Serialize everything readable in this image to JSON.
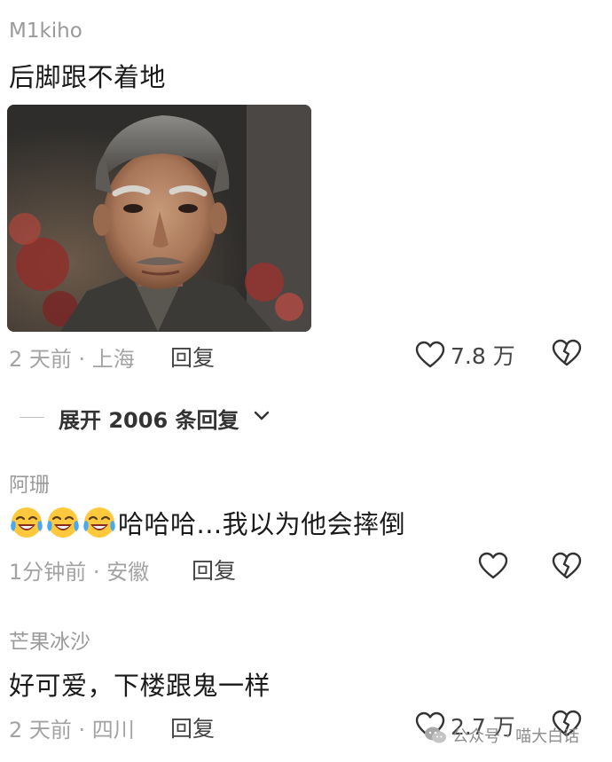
{
  "comments": [
    {
      "username": "M1kiho",
      "text": "后脚跟不着地",
      "meta": "2 天前 · 上海",
      "reply_label": "回复",
      "likes": "7.8 万"
    },
    {
      "username": "阿珊",
      "text": "哈哈哈...我以为他会摔倒",
      "emoji": [
        "laugh-cry-emoji",
        "laugh-cry-emoji",
        "laugh-cry-emoji"
      ],
      "meta": "1分钟前 · 安徽",
      "reply_label": "回复",
      "likes": ""
    },
    {
      "username": "芒果冰沙",
      "text": "好可爱，下楼跟鬼一样",
      "meta": "2 天前 · 四川",
      "reply_label": "回复",
      "likes": "2.7 万"
    }
  ],
  "expand_replies": {
    "label": "展开 2006 条回复"
  },
  "watermark": {
    "text": "公众号 · 喵大白话"
  },
  "icons": {
    "like": "heart-outline-icon",
    "dislike": "broken-heart-icon",
    "expand": "chevron-down-icon",
    "watermark": "wechat-icon"
  },
  "colors": {
    "meta": "#a3a3a3",
    "username": "#9a9a9a",
    "text": "#1a1a1a"
  }
}
